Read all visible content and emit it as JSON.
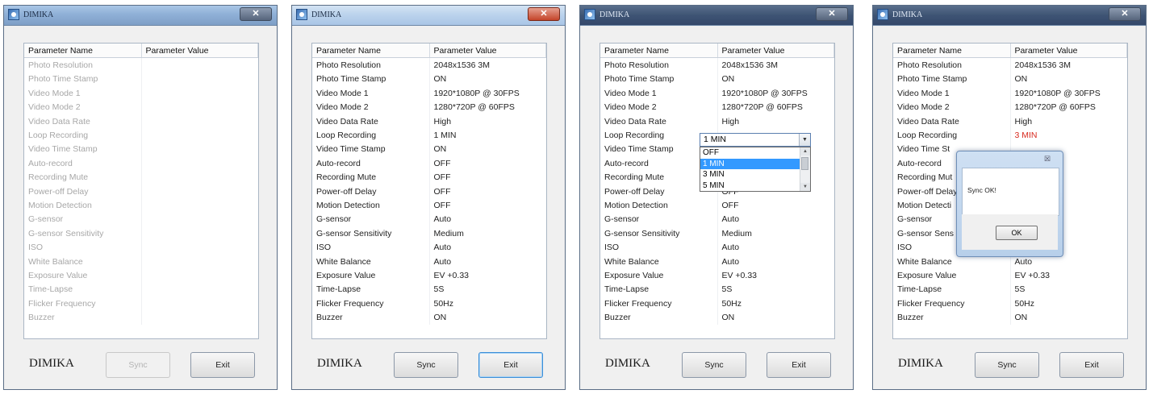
{
  "app": {
    "title": "DIMIKA",
    "brand": "DIMIKA"
  },
  "headers": {
    "name": "Parameter Name",
    "value": "Parameter Value"
  },
  "parameters": [
    "Photo Resolution",
    "Photo Time Stamp",
    "Video Mode 1",
    "Video Mode 2",
    "Video Data Rate",
    "Loop Recording",
    "Video Time Stamp",
    "Auto-record",
    "Recording Mute",
    "Power-off Delay",
    "Motion Detection",
    "G-sensor",
    "G-sensor Sensitivity",
    "ISO",
    "White Balance",
    "Exposure Value",
    "Time-Lapse",
    "Flicker Frequency",
    "Buzzer"
  ],
  "values": [
    "2048x1536 3M",
    "ON",
    "1920*1080P @ 30FPS",
    "1280*720P @ 60FPS",
    "High",
    "1 MIN",
    "ON",
    "OFF",
    "OFF",
    "OFF",
    "OFF",
    "Auto",
    "Medium",
    "Auto",
    "Auto",
    "EV +0.33",
    "5S",
    "50Hz",
    "ON"
  ],
  "window4_values": [
    "2048x1536 3M",
    "ON",
    "1920*1080P @ 30FPS",
    "1280*720P @ 60FPS",
    "High",
    "3 MIN",
    "",
    "",
    "",
    "",
    "",
    "",
    "",
    "",
    "Auto",
    "EV +0.33",
    "5S",
    "50Hz",
    "ON"
  ],
  "window4_parameters": [
    "Photo Resolution",
    "Photo Time Stamp",
    "Video Mode 1",
    "Video Mode 2",
    "Video Data Rate",
    "Loop Recording",
    "Video Time St",
    "Auto-record",
    "Recording Mut",
    "Power-off Delay",
    "Motion Detecti",
    "G-sensor",
    "G-sensor Sens",
    "ISO",
    "White Balance",
    "Exposure Value",
    "Time-Lapse",
    "Flicker Frequency",
    "Buzzer"
  ],
  "buttons": {
    "sync": "Sync",
    "exit": "Exit"
  },
  "window3": {
    "combo_value": "1 MIN",
    "options": [
      "OFF",
      "1 MIN",
      "3 MIN",
      "5 MIN"
    ],
    "selected_option": "1 MIN"
  },
  "dialog": {
    "message": "Sync OK!",
    "ok": "OK",
    "close": "☒"
  },
  "icons": {
    "close": "x-icon",
    "dropdown": "chevron-down-icon"
  },
  "colors": {
    "highlight": "#3399ff",
    "changed_value": "#d82a1f",
    "disabled_text": "#a7a7a7"
  }
}
